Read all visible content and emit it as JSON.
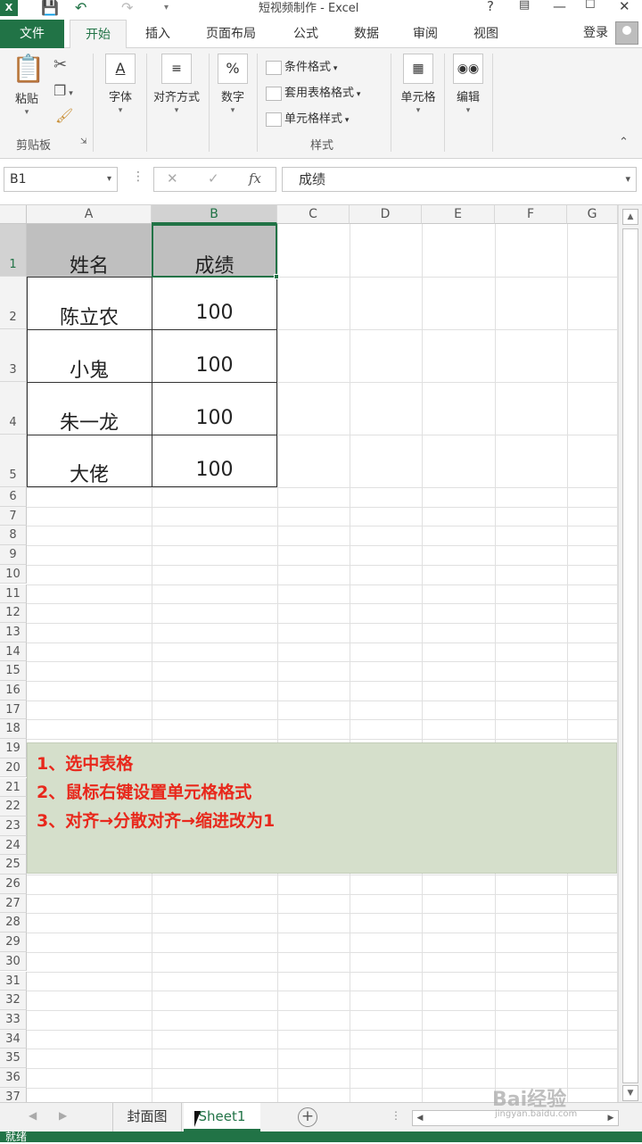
{
  "window": {
    "title": "短视频制作 - Excel",
    "help": "?",
    "logo_text": "X"
  },
  "tabs": {
    "file": "文件",
    "items": [
      "开始",
      "插入",
      "页面布局",
      "公式",
      "数据",
      "审阅",
      "视图"
    ],
    "active": "开始",
    "login": "登录"
  },
  "ribbon": {
    "paste": "粘贴",
    "clipboard_group": "剪贴板",
    "font": "字体",
    "alignment": "对齐方式",
    "number": "数字",
    "number_symbol": "%",
    "cond_format": "条件格式",
    "table_format": "套用表格格式",
    "cell_style": "单元格样式",
    "styles_group": "样式",
    "cells": "单元格",
    "editing": "编辑",
    "font_symbol": "A"
  },
  "formula_bar": {
    "name_box": "B1",
    "fx": "fx",
    "content": "成绩"
  },
  "grid": {
    "columns": [
      "A",
      "B",
      "C",
      "D",
      "E",
      "F",
      "G"
    ],
    "selected_column": "B",
    "rows": [
      "1",
      "2",
      "3",
      "4",
      "5",
      "6",
      "7",
      "8",
      "9",
      "10",
      "11",
      "12",
      "13",
      "14",
      "15",
      "16",
      "17",
      "18",
      "19",
      "20",
      "21",
      "22",
      "23",
      "24",
      "25",
      "26",
      "27",
      "28",
      "29",
      "30",
      "31",
      "32",
      "33",
      "34",
      "35",
      "36",
      "37"
    ],
    "table": {
      "headers": [
        "姓名",
        "成绩"
      ],
      "rows": [
        [
          "陈立农",
          "100"
        ],
        [
          "小鬼",
          "100"
        ],
        [
          "朱一龙",
          "100"
        ],
        [
          "大佬",
          "100"
        ]
      ]
    }
  },
  "note": {
    "lines": [
      "1、选中表格",
      "2、鼠标右键设置单元格格式",
      "3、对齐→分散对齐→缩进改为1"
    ],
    "text_color": "#e8281c",
    "bg_color": "#d5dfcb"
  },
  "sheet_tabs": {
    "items": [
      "封面图",
      "Sheet1"
    ],
    "active": "Sheet1"
  },
  "status": {
    "ready": "就绪"
  },
  "watermark": {
    "brand": "Bai经验",
    "url": "jingyan.baidu.com"
  },
  "colors": {
    "accent": "#217346"
  }
}
